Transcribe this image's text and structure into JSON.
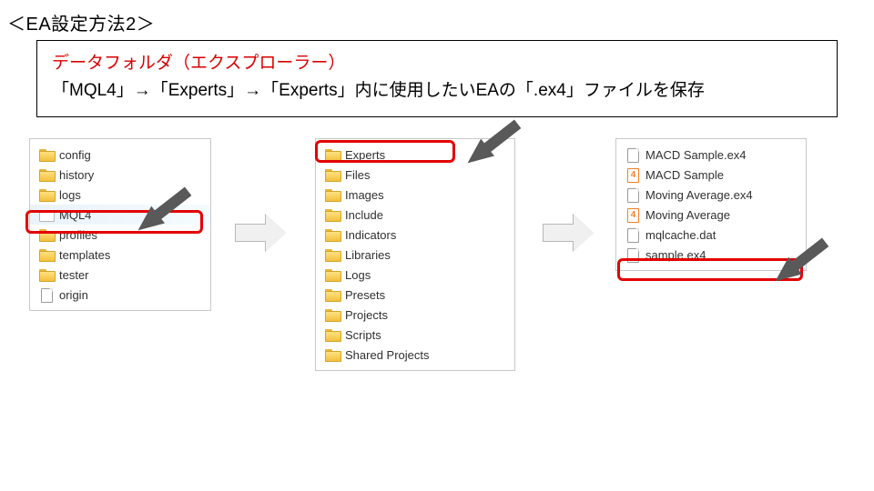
{
  "title": "＜EA設定方法2＞",
  "instruction": {
    "line1": "データフォルダ（エクスプローラー）",
    "line2": "「MQL4」→「Experts」→「Experts」内に使用したいEAの「.ex4」ファイルを保存"
  },
  "panel1": {
    "items": [
      {
        "label": "config",
        "icon": "folder"
      },
      {
        "label": "history",
        "icon": "folder"
      },
      {
        "label": "logs",
        "icon": "folder"
      },
      {
        "label": "MQL4",
        "icon": "folder-outline",
        "highlight": true,
        "selected": true
      },
      {
        "label": "profiles",
        "icon": "folder"
      },
      {
        "label": "templates",
        "icon": "folder"
      },
      {
        "label": "tester",
        "icon": "folder"
      },
      {
        "label": "origin",
        "icon": "file"
      }
    ]
  },
  "panel2": {
    "items": [
      {
        "label": "Experts",
        "icon": "folder",
        "highlight": true
      },
      {
        "label": "Files",
        "icon": "folder"
      },
      {
        "label": "Images",
        "icon": "folder"
      },
      {
        "label": "Include",
        "icon": "folder"
      },
      {
        "label": "Indicators",
        "icon": "folder"
      },
      {
        "label": "Libraries",
        "icon": "folder"
      },
      {
        "label": "Logs",
        "icon": "folder"
      },
      {
        "label": "Presets",
        "icon": "folder"
      },
      {
        "label": "Projects",
        "icon": "folder"
      },
      {
        "label": "Scripts",
        "icon": "folder"
      },
      {
        "label": "Shared Projects",
        "icon": "folder"
      }
    ]
  },
  "panel3": {
    "items": [
      {
        "label": "MACD Sample.ex4",
        "icon": "file"
      },
      {
        "label": "MACD Sample",
        "icon": "mt4file"
      },
      {
        "label": "Moving Average.ex4",
        "icon": "file"
      },
      {
        "label": "Moving Average",
        "icon": "mt4file"
      },
      {
        "label": "mqlcache.dat",
        "icon": "file"
      },
      {
        "label": "sample.ex4",
        "icon": "file",
        "highlight": true
      }
    ]
  }
}
